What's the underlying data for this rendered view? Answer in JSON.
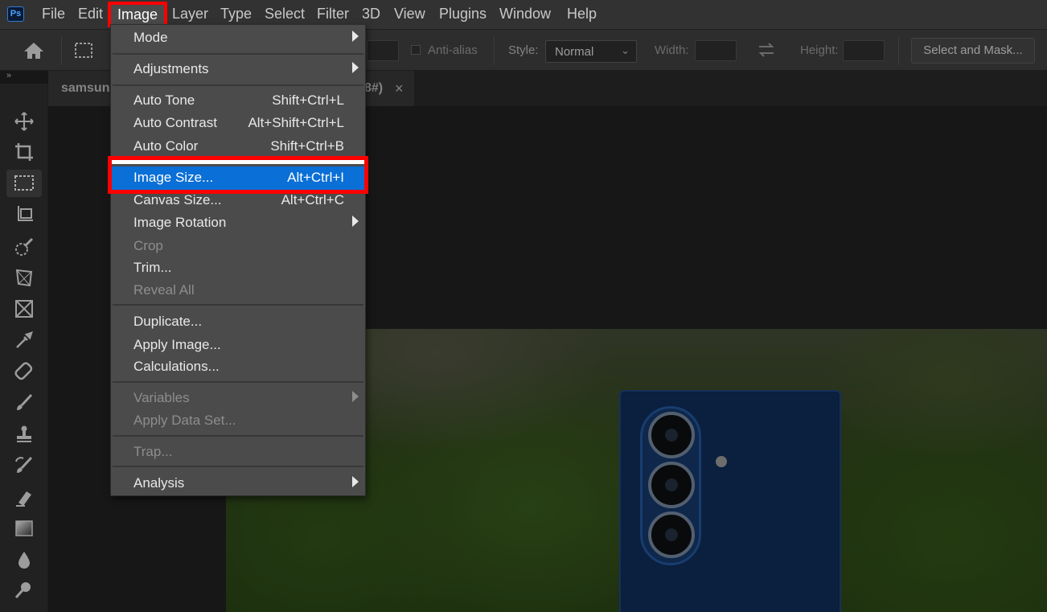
{
  "app": {
    "logo_text": "Ps"
  },
  "menubar": {
    "items": [
      "File",
      "Edit",
      "Image",
      "Layer",
      "Type",
      "Select",
      "Filter",
      "3D",
      "View",
      "Plugins",
      "Window",
      "Help"
    ]
  },
  "options_bar": {
    "anti_alias_label": "Anti-alias",
    "style_label": "Style:",
    "style_value": "Normal",
    "width_label": "Width:",
    "height_label": "Height:",
    "select_mask_label": "Select and Mask..."
  },
  "document": {
    "tab_name": "samsung",
    "tab_suffix": "8#)",
    "close_glyph": "×",
    "panel_toggle": "»"
  },
  "image_menu": {
    "items": [
      {
        "label": "Mode",
        "shortcut": "",
        "submenu": true,
        "disabled": false
      },
      {
        "label": "Adjustments",
        "shortcut": "",
        "submenu": true,
        "disabled": false
      },
      {
        "label": "Auto Tone",
        "shortcut": "Shift+Ctrl+L",
        "submenu": false,
        "disabled": false
      },
      {
        "label": "Auto Contrast",
        "shortcut": "Alt+Shift+Ctrl+L",
        "submenu": false,
        "disabled": false
      },
      {
        "label": "Auto Color",
        "shortcut": "Shift+Ctrl+B",
        "submenu": false,
        "disabled": false
      },
      {
        "label": "Image Size...",
        "shortcut": "Alt+Ctrl+I",
        "submenu": false,
        "disabled": false,
        "highlighted": true
      },
      {
        "label": "Canvas Size...",
        "shortcut": "Alt+Ctrl+C",
        "submenu": false,
        "disabled": false
      },
      {
        "label": "Image Rotation",
        "shortcut": "",
        "submenu": true,
        "disabled": false
      },
      {
        "label": "Crop",
        "shortcut": "",
        "submenu": false,
        "disabled": true
      },
      {
        "label": "Trim...",
        "shortcut": "",
        "submenu": false,
        "disabled": false
      },
      {
        "label": "Reveal All",
        "shortcut": "",
        "submenu": false,
        "disabled": true
      },
      {
        "label": "Duplicate...",
        "shortcut": "",
        "submenu": false,
        "disabled": false
      },
      {
        "label": "Apply Image...",
        "shortcut": "",
        "submenu": false,
        "disabled": false
      },
      {
        "label": "Calculations...",
        "shortcut": "",
        "submenu": false,
        "disabled": false
      },
      {
        "label": "Variables",
        "shortcut": "",
        "submenu": true,
        "disabled": true
      },
      {
        "label": "Apply Data Set...",
        "shortcut": "",
        "submenu": false,
        "disabled": true
      },
      {
        "label": "Trap...",
        "shortcut": "",
        "submenu": false,
        "disabled": true
      },
      {
        "label": "Analysis",
        "shortcut": "",
        "submenu": true,
        "disabled": false
      }
    ]
  },
  "colors": {
    "highlight": "#0a6fd6",
    "annotation_red": "#ff0000",
    "menu_bg": "#4b4b4b",
    "app_bg": "#323232"
  },
  "tools": [
    "move-tool",
    "crop-tool",
    "marquee-tool",
    "frame-tool",
    "quick-selection-tool",
    "perspective-crop-tool",
    "frame-x-tool",
    "eyedropper-tool",
    "spot-healing-tool",
    "brush-tool",
    "clone-stamp-tool",
    "history-brush-tool",
    "eraser-tool",
    "gradient-tool",
    "blur-tool",
    "dodge-tool"
  ]
}
